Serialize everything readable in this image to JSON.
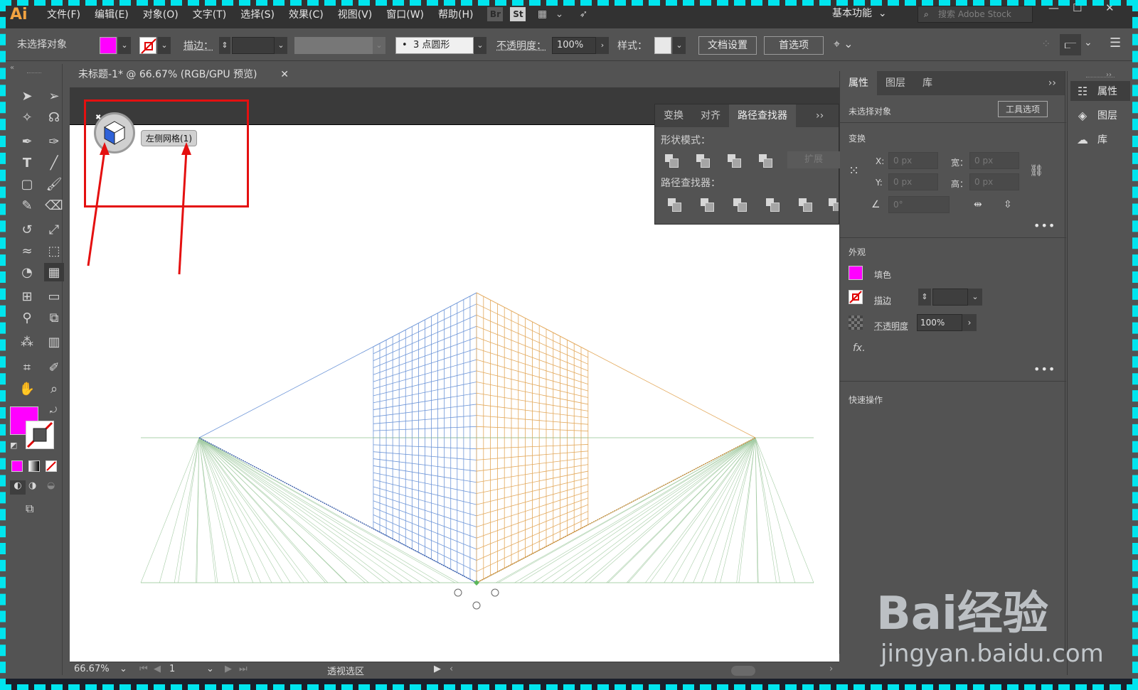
{
  "app": {
    "logo": "Ai",
    "menu": [
      "文件(F)",
      "编辑(E)",
      "对象(O)",
      "文字(T)",
      "选择(S)",
      "效果(C)",
      "视图(V)",
      "窗口(W)",
      "帮助(H)"
    ],
    "bridge": "Br",
    "stock": "St",
    "workspace": "基本功能",
    "search_placeholder": "搜索 Adobe Stock"
  },
  "control": {
    "selection": "未选择对象",
    "stroke_label": "描边：",
    "brush": "3 点圆形",
    "opacity_label": "不透明度：",
    "opacity_value": "100%",
    "style_label": "样式：",
    "doc_setup": "文档设置",
    "preferences": "首选项",
    "fill_color": "#ff00ff"
  },
  "document": {
    "tab_title": "未标题-1* @ 66.67% (RGB/GPU 预览)",
    "widget_tooltip": "左侧网格(1)"
  },
  "pathfinder": {
    "tabs": [
      "变换",
      "对齐",
      "路径查找器"
    ],
    "shape_modes_label": "形状模式：",
    "expand": "扩展",
    "pathfinders_label": "路径查找器："
  },
  "properties": {
    "tabs": [
      "属性",
      "图层",
      "库"
    ],
    "selection": "未选择对象",
    "tool_options": "工具选项",
    "transform_label": "变换",
    "x_label": "X:",
    "x_value": "0 px",
    "y_label": "Y:",
    "y_value": "0 px",
    "w_label": "宽：",
    "w_value": "0 px",
    "h_label": "高：",
    "h_value": "0 px",
    "angle_value": "0°",
    "appearance_label": "外观",
    "fill_label": "填色",
    "stroke_label": "描边",
    "opacity_label": "不透明度",
    "opacity_value": "100%",
    "fx": "fx.",
    "quick_actions": "快速操作"
  },
  "dock": [
    {
      "label": "属性"
    },
    {
      "label": "图层"
    },
    {
      "label": "库"
    }
  ],
  "status": {
    "zoom": "66.67%",
    "artboard": "1",
    "mode": "透视选区"
  },
  "watermark": {
    "brand": "Bai经验",
    "url": "jingyan.baidu.com"
  }
}
